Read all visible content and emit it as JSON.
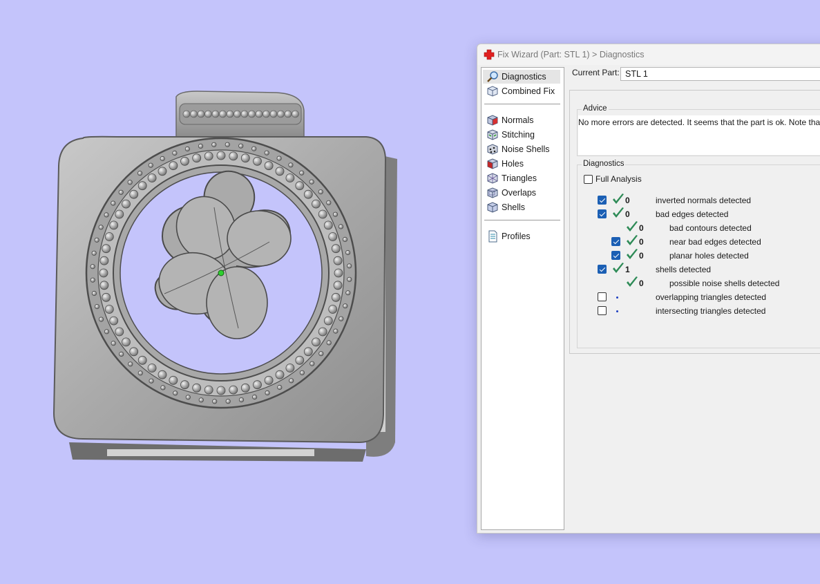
{
  "dialog": {
    "title": "Fix Wizard (Part: STL 1) > Diagnostics",
    "icon": "red-cross-icon"
  },
  "nav": {
    "group1": [
      {
        "label": "Diagnostics",
        "icon": "magnifier-icon",
        "selected": true
      },
      {
        "label": "Combined Fix",
        "icon": "cube-icon",
        "selected": false
      }
    ],
    "group2": [
      {
        "label": "Normals",
        "icon": "normals-cube-icon"
      },
      {
        "label": "Stitching",
        "icon": "stitching-cube-icon"
      },
      {
        "label": "Noise Shells",
        "icon": "noise-shells-icon"
      },
      {
        "label": "Holes",
        "icon": "holes-cube-icon"
      },
      {
        "label": "Triangles",
        "icon": "triangles-icon"
      },
      {
        "label": "Overlaps",
        "icon": "overlaps-icon"
      },
      {
        "label": "Shells",
        "icon": "shells-icon"
      }
    ],
    "group3": [
      {
        "label": "Profiles",
        "icon": "document-icon"
      }
    ]
  },
  "current_part": {
    "label": "Current Part:",
    "value": "STL 1"
  },
  "advice": {
    "title": "Advice",
    "text": "No more errors are detected. It seems that the part is ok. Note that no"
  },
  "diagnostics": {
    "title": "Diagnostics",
    "full_analysis_label": "Full Analysis",
    "full_analysis_checked": false,
    "rows": [
      {
        "label": "inverted normals detected",
        "count": "0",
        "checkbox": true,
        "checked": true,
        "status": "ok",
        "indent": 0
      },
      {
        "label": "bad edges detected",
        "count": "0",
        "checkbox": true,
        "checked": true,
        "status": "ok",
        "indent": 0
      },
      {
        "label": "bad contours detected",
        "count": "0",
        "checkbox": false,
        "checked": false,
        "status": "ok",
        "indent": 2
      },
      {
        "label": "near bad edges detected",
        "count": "0",
        "checkbox": true,
        "checked": true,
        "status": "ok",
        "indent": 1
      },
      {
        "label": "planar holes detected",
        "count": "0",
        "checkbox": true,
        "checked": true,
        "status": "ok",
        "indent": 1
      },
      {
        "label": "shells detected",
        "count": "1",
        "checkbox": true,
        "checked": true,
        "status": "ok",
        "indent": 0
      },
      {
        "label": "possible noise shells detected",
        "count": "0",
        "checkbox": false,
        "checked": false,
        "status": "ok",
        "indent": 2
      },
      {
        "label": "overlapping triangles detected",
        "count": "",
        "checkbox": true,
        "checked": false,
        "status": "pending",
        "indent": 0
      },
      {
        "label": "intersecting triangles detected",
        "count": "",
        "checkbox": true,
        "checked": false,
        "status": "pending",
        "indent": 0
      }
    ]
  },
  "colors": {
    "background": "#c4c4fb",
    "check_green": "#2e8b57",
    "checkbox_blue": "#1b5fb4",
    "title_icon_red": "#e02020"
  }
}
